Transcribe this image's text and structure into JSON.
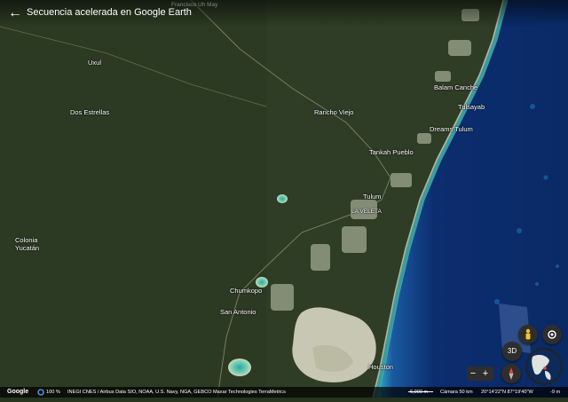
{
  "header": {
    "title": "Secuencia acelerada en Google Earth",
    "back_icon": "arrow-left-icon"
  },
  "places": {
    "uxul": "Uxul",
    "dos_estrellas": "Dos Estrellas",
    "rancho_viejo": "Rancho Viejo",
    "balam_canche": "Balam Canche",
    "tulsayab": "Tulsayab",
    "dreams_tulum": "Dreams Tulum",
    "tankah_pueblo": "Tankah Pueblo",
    "tulum": "Tulum",
    "la_veleta": "LA VELETA",
    "colonia_yucatan": "Colonia Yucatán",
    "chumkopo": "Chumkopo",
    "san_antonio": "San Antonio",
    "houston": "Houston",
    "faint_top": "Francisco Uh May"
  },
  "controls": {
    "three_d": "3D",
    "zoom_out": "−",
    "zoom_in": "+"
  },
  "footer": {
    "logo": "Google",
    "zoom_level": "100 %",
    "credits": "INEGI   CNES / Airbus   Data SIO, NOAA, U.S. Navy, NGA, GEBCO   Maxar Technologies   TerraMetrics",
    "scale": "6,000 m",
    "camera": "Cámara  50 km",
    "coords": "20°14'22\"N 87°19'40\"W",
    "elevation": "-9 m"
  },
  "colors": {
    "land": "#2f3d26",
    "sea_deep": "#0c2d6e",
    "sea_shallow": "#29a6c5",
    "cenote": "#6ad0b5"
  }
}
